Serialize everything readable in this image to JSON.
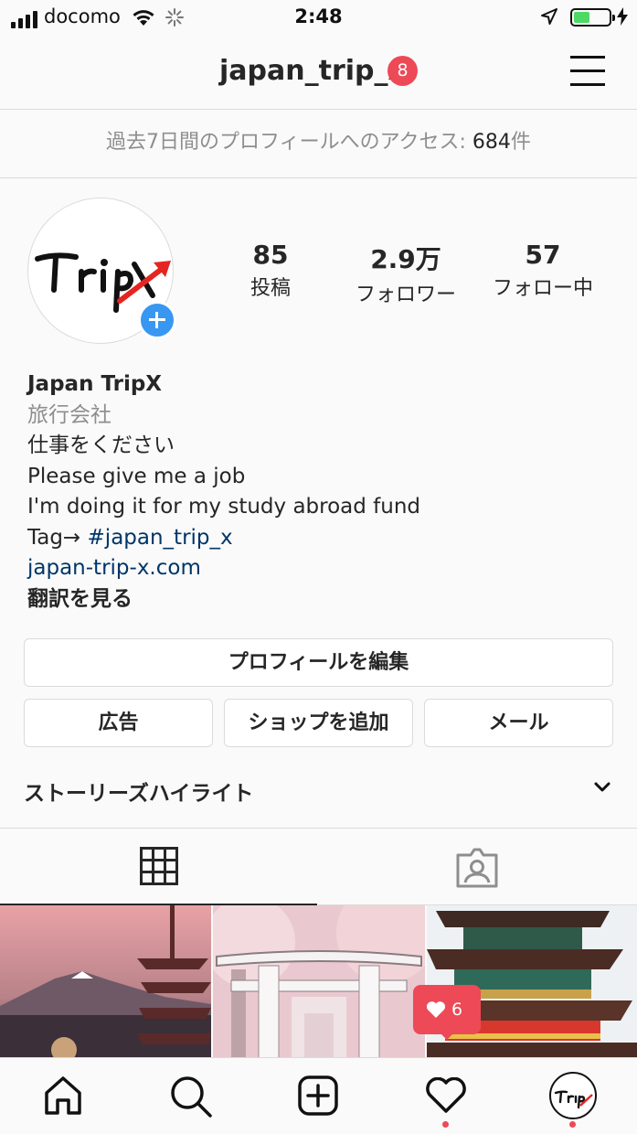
{
  "status_bar": {
    "carrier": "docomo",
    "time": "2:48",
    "battery_level": 0.45,
    "colors": {
      "battery_fill": "#4cd964"
    }
  },
  "header": {
    "username": "japan_trip_x",
    "notification_count": "8",
    "menu_icon": "hamburger-icon"
  },
  "insights": {
    "prefix": "過去7日間のプロフィールへのアクセス: ",
    "count": "684",
    "suffix": "件"
  },
  "profile": {
    "stats": [
      {
        "value": "85",
        "label": "投稿"
      },
      {
        "value": "2.9万",
        "label": "フォロワー"
      },
      {
        "value": "57",
        "label": "フォロー中"
      }
    ],
    "name": "Japan TripX",
    "category": "旅行会社",
    "bio_lines": [
      "仕事をください",
      "Please give me a job",
      "I'm doing it for my study abroad fund"
    ],
    "tag_prefix": "Tag→ ",
    "tag": "#japan_trip_x",
    "website": "japan-trip-x.com",
    "see_translation": "翻訳を見る"
  },
  "buttons": {
    "edit_profile": "プロフィールを編集",
    "promotions": "広告",
    "add_shop": "ショップを追加",
    "email": "メール"
  },
  "story_highlights": {
    "label": "ストーリーズハイライト"
  },
  "tabs": [
    {
      "icon": "grid-icon",
      "active": true
    },
    {
      "icon": "tagged-person-icon",
      "active": false
    }
  ],
  "photos": [
    {
      "subject": "Mt. Fuji with pagoda at dusk"
    },
    {
      "subject": "White torii gate under cherry blossoms"
    },
    {
      "subject": "Colorful pagoda"
    }
  ],
  "activity_popup": {
    "icon": "heart-icon",
    "count": "6"
  },
  "bottom_nav": [
    {
      "icon": "home-icon"
    },
    {
      "icon": "search-icon"
    },
    {
      "icon": "new-post-icon"
    },
    {
      "icon": "activity-heart-icon",
      "has_dot": true
    },
    {
      "icon": "profile-avatar",
      "has_dot": true
    }
  ],
  "colors": {
    "accent": "#3897f0",
    "notification": "#ed4956",
    "link": "#003569",
    "muted_text": "#8e8e8e",
    "border": "#dbdbdb"
  }
}
